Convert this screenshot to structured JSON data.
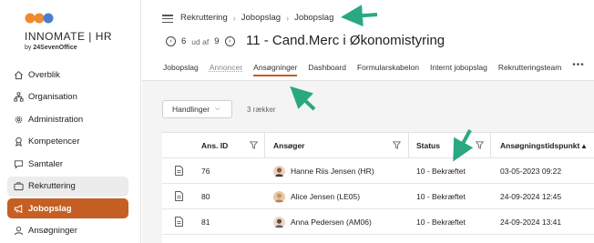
{
  "brand": {
    "name": "INNOMATE | HR",
    "sub_prefix": "by",
    "sub_company": "24SevenOffice",
    "colors": {
      "orange": "#f08a2c",
      "blue": "#4a7fd0",
      "accent": "#c55f24"
    }
  },
  "sidebar": {
    "items": [
      {
        "label": "Overblik",
        "icon": "home-icon",
        "state": "normal"
      },
      {
        "label": "Organisation",
        "icon": "org-icon",
        "state": "normal"
      },
      {
        "label": "Administration",
        "icon": "gear-icon",
        "state": "normal"
      },
      {
        "label": "Kompetencer",
        "icon": "certificate-icon",
        "state": "normal"
      },
      {
        "label": "Samtaler",
        "icon": "chat-icon",
        "state": "normal"
      },
      {
        "label": "Rekruttering",
        "icon": "briefcase-icon",
        "state": "selected"
      },
      {
        "label": "Jobopslag",
        "icon": "megaphone-icon",
        "state": "active"
      },
      {
        "label": "Ansøgninger",
        "icon": "user-icon",
        "state": "normal"
      }
    ]
  },
  "breadcrumb": [
    "Rekruttering",
    "Jobopslag",
    "Jobopslag"
  ],
  "pager": {
    "current": "6",
    "of_label": "ud af",
    "total": "9"
  },
  "page_title": "11 - Cand.Merc i Økonomistyring",
  "tabs": [
    {
      "label": "Jobopslag",
      "state": "normal"
    },
    {
      "label": "Annoncer",
      "state": "muted"
    },
    {
      "label": "Ansøgninger",
      "state": "active"
    },
    {
      "label": "Dashboard",
      "state": "normal"
    },
    {
      "label": "Formularskabelon",
      "state": "normal"
    },
    {
      "label": "Internt jobopslag",
      "state": "normal"
    },
    {
      "label": "Rekrutteringsteam",
      "state": "normal"
    }
  ],
  "toolbar": {
    "actions_label": "Handlinger",
    "rows_label": "3 rækker"
  },
  "table": {
    "columns": [
      "Ans. ID",
      "Ansøger",
      "Status",
      "Ansøgningstidspunkt"
    ],
    "rows": [
      {
        "id": "76",
        "applicant": "Hanne Riis Jensen (HR)",
        "status": "10 - Bekræftet",
        "time": "03-05-2023 09:22"
      },
      {
        "id": "80",
        "applicant": "Alice Jensen (LE05)",
        "status": "10 - Bekræftet",
        "time": "24-09-2024 12:45"
      },
      {
        "id": "81",
        "applicant": "Anna Pedersen (AM06)",
        "status": "10 - Bekræftet",
        "time": "24-09-2024 13:41"
      }
    ]
  },
  "annotation_color": "#2aa882"
}
